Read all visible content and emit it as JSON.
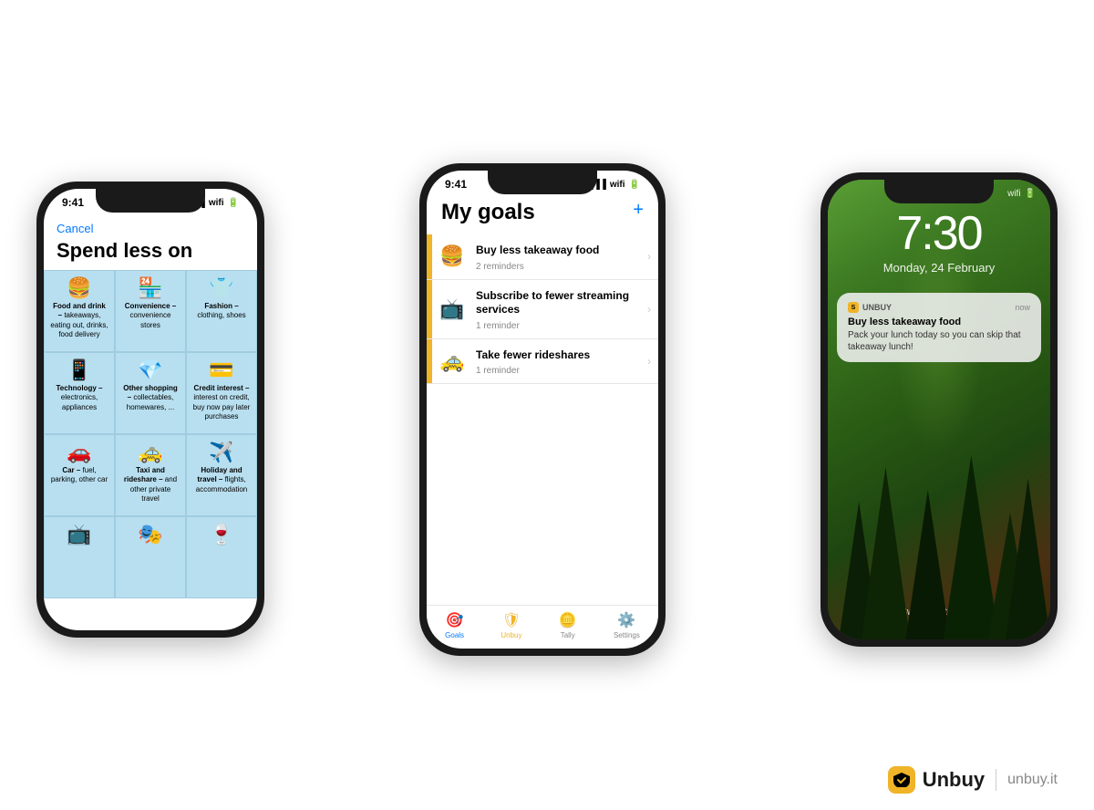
{
  "phone1": {
    "status_time": "9:41",
    "cancel_label": "Cancel",
    "title": "Spend less on",
    "grid": [
      {
        "icon": "🍔",
        "label_strong": "Food and drink –",
        "label_rest": " takeaways, eating out, drinks, food delivery"
      },
      {
        "icon": "🏪",
        "label_strong": "Convenience –",
        "label_rest": " convenience stores"
      },
      {
        "icon": "👕",
        "label_strong": "Fashion –",
        "label_rest": " clothing, shoes"
      },
      {
        "icon": "📱",
        "label_strong": "Technology –",
        "label_rest": " electronics, appliances"
      },
      {
        "icon": "💎",
        "label_strong": "Other shopping –",
        "label_rest": " collectables, homewares, ..."
      },
      {
        "icon": "💳",
        "label_strong": "Credit interest –",
        "label_rest": " interest on credit, buy now pay later purchases"
      },
      {
        "icon": "🚗",
        "label_strong": "Car –",
        "label_rest": " fuel, parking, other car"
      },
      {
        "icon": "🚕",
        "label_strong": "Taxi and rideshare –",
        "label_rest": " and other private travel"
      },
      {
        "icon": "✈️",
        "label_strong": "Holiday and travel –",
        "label_rest": " flights, accommodation"
      },
      {
        "icon": "📺",
        "label_strong": "",
        "label_rest": ""
      },
      {
        "icon": "🎭",
        "label_strong": "",
        "label_rest": ""
      },
      {
        "icon": "🍷",
        "label_strong": "",
        "label_rest": ""
      }
    ]
  },
  "phone2": {
    "status_time": "9:41",
    "title": "My goals",
    "plus_label": "+",
    "goals": [
      {
        "icon": "🍔",
        "title": "Buy less takeaway food",
        "reminder": "2 reminders",
        "highlighted": true
      },
      {
        "icon": "📺",
        "title": "Subscribe to fewer streaming services",
        "reminder": "1 reminder",
        "highlighted": true
      },
      {
        "icon": "🚕",
        "title": "Take fewer rideshares",
        "reminder": "1 reminder",
        "highlighted": true
      }
    ],
    "tabs": [
      {
        "icon": "🎯",
        "label": "Goals",
        "active": true
      },
      {
        "icon": "🛡",
        "label": "Unbuy",
        "active": false
      },
      {
        "icon": "🪙",
        "label": "Tally",
        "active": false
      },
      {
        "icon": "⚙️",
        "label": "Settings",
        "active": false
      }
    ]
  },
  "phone3": {
    "time": "7:30",
    "date": "Monday, 24 February",
    "notification": {
      "app_name": "UNBUY",
      "time": "now",
      "title": "Buy less takeaway food",
      "body": "Pack your lunch today so you can skip that takeaway lunch!"
    },
    "swipe_label": "Swipe up to open"
  },
  "branding": {
    "logo_text": "S",
    "name": "Unbuy",
    "url": "unbuy.it"
  }
}
